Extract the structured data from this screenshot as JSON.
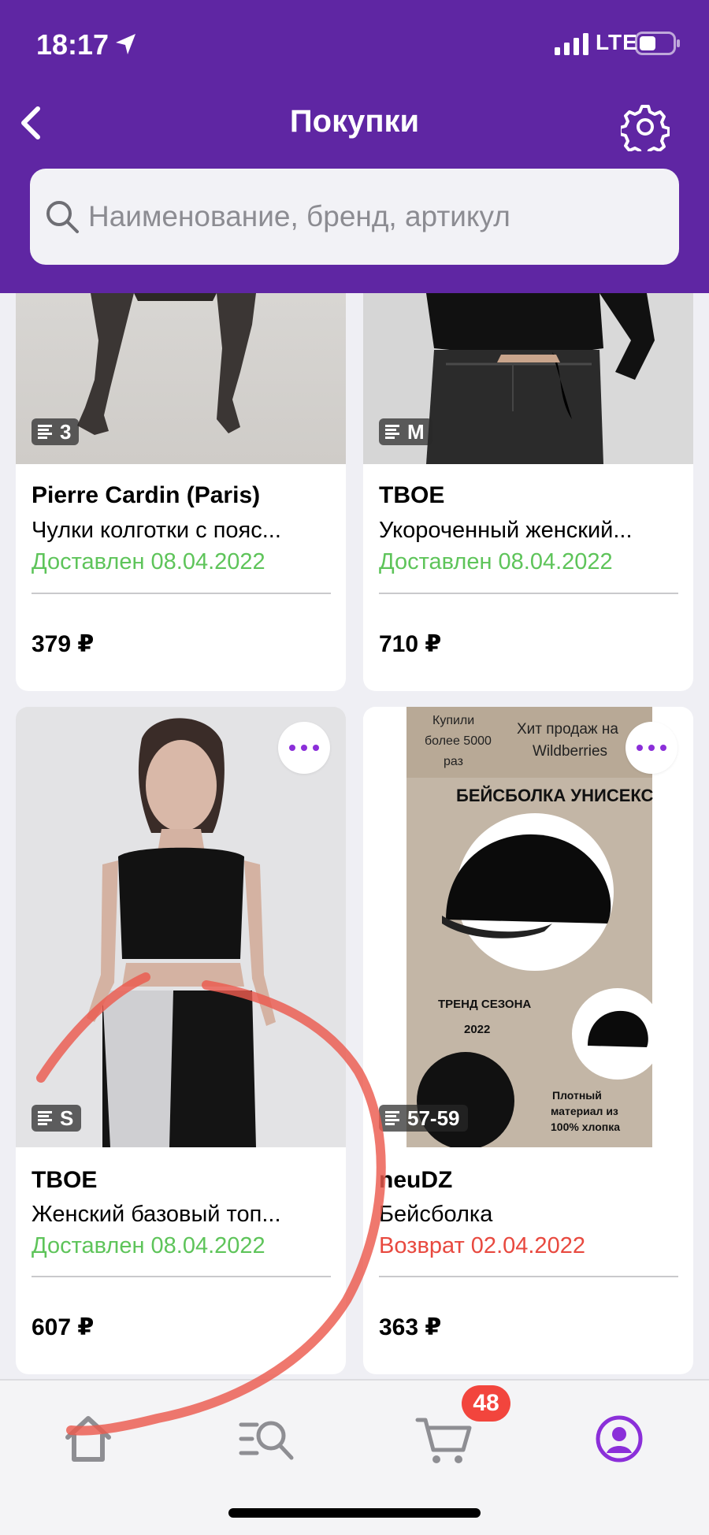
{
  "status_bar": {
    "time": "18:17",
    "network": "LTE"
  },
  "header": {
    "title": "Покупки"
  },
  "search": {
    "placeholder": "Наименование, бренд, артикул"
  },
  "products": [
    {
      "brand": "Pierre Cardin (Paris)",
      "name": "Чулки колготки с пояс...",
      "status": "Доставлен 08.04.2022",
      "status_color": "#5ec45a",
      "price": "379 ₽",
      "size": "3"
    },
    {
      "brand": "TBOE",
      "name": "Укороченный женский...",
      "status": "Доставлен 08.04.2022",
      "status_color": "#5ec45a",
      "price": "710 ₽",
      "size": "M"
    },
    {
      "brand": "TBOE",
      "name": "Женский базовый топ...",
      "status": "Доставлен 08.04.2022",
      "status_color": "#5ec45a",
      "price": "607 ₽",
      "size": "S"
    },
    {
      "brand": "neuDZ",
      "name": "Бейсболка",
      "status": "Возврат 02.04.2022",
      "status_color": "#e8493f",
      "price": "363 ₽",
      "size": "57-59",
      "image_text": {
        "bought": "Купили более 5000 раз",
        "hit": "Хит продаж на Wildberries",
        "title": "БЕЙСБОЛКА УНИСЕКС",
        "trend": "ТРЕНД СЕЗОНА 2022",
        "material": "Плотный материал из 100% хлопка"
      }
    }
  ],
  "tabbar": {
    "cart_count": "48"
  },
  "colors": {
    "brand_purple": "#5f26a3",
    "accent": "#8b2fd9",
    "delivered": "#5ec45a",
    "returned": "#e8493f",
    "badge": "#f2453d"
  },
  "icons": [
    "location-arrow-icon",
    "signal-icon",
    "battery-icon",
    "chevron-left-icon",
    "gear-icon",
    "search-icon",
    "list-icon",
    "more-dots-icon",
    "home-icon",
    "catalog-search-icon",
    "cart-icon",
    "profile-icon"
  ]
}
